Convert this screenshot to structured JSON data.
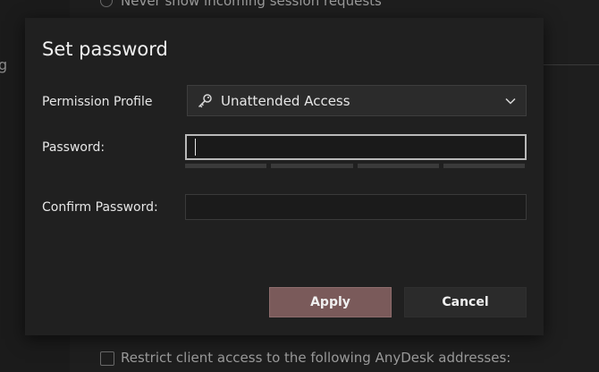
{
  "background": {
    "top_text": "Never show incoming session requests",
    "sidebar_letter": "g",
    "bottom_text": "Restrict client access to the following AnyDesk addresses:"
  },
  "dialog": {
    "title": "Set password",
    "permission_profile": {
      "label": "Permission Profile",
      "value": "Unattended Access",
      "icon": "key-icon"
    },
    "password": {
      "label": "Password:",
      "value": ""
    },
    "strength_segments": 4,
    "confirm_password": {
      "label": "Confirm Password:",
      "value": ""
    },
    "buttons": {
      "apply": "Apply",
      "cancel": "Cancel"
    }
  },
  "colors": {
    "apply_button": "#7a5a5a",
    "dialog_bg": "#202020",
    "focus_border": "#b9b9b9"
  }
}
